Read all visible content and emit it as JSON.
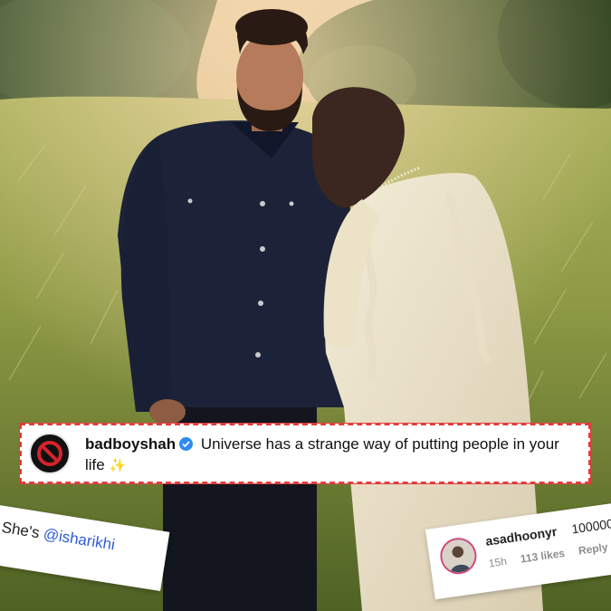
{
  "caption": {
    "username": "badboyshah",
    "text": "Universe has a strange way of putting people in your life",
    "emoji": "✨"
  },
  "comment_left": {
    "prefix": "She's ",
    "mention": "@isharikhi"
  },
  "comment_right": {
    "username": "asadhoonyr",
    "text": "100000",
    "time": "15h",
    "likes": "113 likes",
    "reply": "Reply"
  },
  "icons": {
    "caption_avatar": "no-entry-icon",
    "verified": "verified-badge-icon"
  }
}
